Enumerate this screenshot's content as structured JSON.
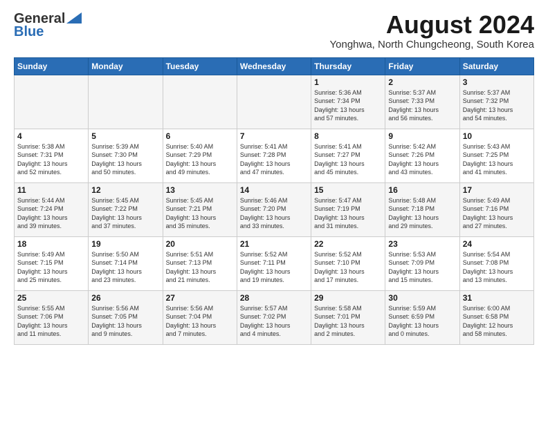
{
  "logo": {
    "general": "General",
    "blue": "Blue"
  },
  "title": "August 2024",
  "location": "Yonghwa, North Chungcheong, South Korea",
  "days_header": [
    "Sunday",
    "Monday",
    "Tuesday",
    "Wednesday",
    "Thursday",
    "Friday",
    "Saturday"
  ],
  "weeks": [
    [
      {
        "num": "",
        "info": ""
      },
      {
        "num": "",
        "info": ""
      },
      {
        "num": "",
        "info": ""
      },
      {
        "num": "",
        "info": ""
      },
      {
        "num": "1",
        "info": "Sunrise: 5:36 AM\nSunset: 7:34 PM\nDaylight: 13 hours\nand 57 minutes."
      },
      {
        "num": "2",
        "info": "Sunrise: 5:37 AM\nSunset: 7:33 PM\nDaylight: 13 hours\nand 56 minutes."
      },
      {
        "num": "3",
        "info": "Sunrise: 5:37 AM\nSunset: 7:32 PM\nDaylight: 13 hours\nand 54 minutes."
      }
    ],
    [
      {
        "num": "4",
        "info": "Sunrise: 5:38 AM\nSunset: 7:31 PM\nDaylight: 13 hours\nand 52 minutes."
      },
      {
        "num": "5",
        "info": "Sunrise: 5:39 AM\nSunset: 7:30 PM\nDaylight: 13 hours\nand 50 minutes."
      },
      {
        "num": "6",
        "info": "Sunrise: 5:40 AM\nSunset: 7:29 PM\nDaylight: 13 hours\nand 49 minutes."
      },
      {
        "num": "7",
        "info": "Sunrise: 5:41 AM\nSunset: 7:28 PM\nDaylight: 13 hours\nand 47 minutes."
      },
      {
        "num": "8",
        "info": "Sunrise: 5:41 AM\nSunset: 7:27 PM\nDaylight: 13 hours\nand 45 minutes."
      },
      {
        "num": "9",
        "info": "Sunrise: 5:42 AM\nSunset: 7:26 PM\nDaylight: 13 hours\nand 43 minutes."
      },
      {
        "num": "10",
        "info": "Sunrise: 5:43 AM\nSunset: 7:25 PM\nDaylight: 13 hours\nand 41 minutes."
      }
    ],
    [
      {
        "num": "11",
        "info": "Sunrise: 5:44 AM\nSunset: 7:24 PM\nDaylight: 13 hours\nand 39 minutes."
      },
      {
        "num": "12",
        "info": "Sunrise: 5:45 AM\nSunset: 7:22 PM\nDaylight: 13 hours\nand 37 minutes."
      },
      {
        "num": "13",
        "info": "Sunrise: 5:45 AM\nSunset: 7:21 PM\nDaylight: 13 hours\nand 35 minutes."
      },
      {
        "num": "14",
        "info": "Sunrise: 5:46 AM\nSunset: 7:20 PM\nDaylight: 13 hours\nand 33 minutes."
      },
      {
        "num": "15",
        "info": "Sunrise: 5:47 AM\nSunset: 7:19 PM\nDaylight: 13 hours\nand 31 minutes."
      },
      {
        "num": "16",
        "info": "Sunrise: 5:48 AM\nSunset: 7:18 PM\nDaylight: 13 hours\nand 29 minutes."
      },
      {
        "num": "17",
        "info": "Sunrise: 5:49 AM\nSunset: 7:16 PM\nDaylight: 13 hours\nand 27 minutes."
      }
    ],
    [
      {
        "num": "18",
        "info": "Sunrise: 5:49 AM\nSunset: 7:15 PM\nDaylight: 13 hours\nand 25 minutes."
      },
      {
        "num": "19",
        "info": "Sunrise: 5:50 AM\nSunset: 7:14 PM\nDaylight: 13 hours\nand 23 minutes."
      },
      {
        "num": "20",
        "info": "Sunrise: 5:51 AM\nSunset: 7:13 PM\nDaylight: 13 hours\nand 21 minutes."
      },
      {
        "num": "21",
        "info": "Sunrise: 5:52 AM\nSunset: 7:11 PM\nDaylight: 13 hours\nand 19 minutes."
      },
      {
        "num": "22",
        "info": "Sunrise: 5:52 AM\nSunset: 7:10 PM\nDaylight: 13 hours\nand 17 minutes."
      },
      {
        "num": "23",
        "info": "Sunrise: 5:53 AM\nSunset: 7:09 PM\nDaylight: 13 hours\nand 15 minutes."
      },
      {
        "num": "24",
        "info": "Sunrise: 5:54 AM\nSunset: 7:08 PM\nDaylight: 13 hours\nand 13 minutes."
      }
    ],
    [
      {
        "num": "25",
        "info": "Sunrise: 5:55 AM\nSunset: 7:06 PM\nDaylight: 13 hours\nand 11 minutes."
      },
      {
        "num": "26",
        "info": "Sunrise: 5:56 AM\nSunset: 7:05 PM\nDaylight: 13 hours\nand 9 minutes."
      },
      {
        "num": "27",
        "info": "Sunrise: 5:56 AM\nSunset: 7:04 PM\nDaylight: 13 hours\nand 7 minutes."
      },
      {
        "num": "28",
        "info": "Sunrise: 5:57 AM\nSunset: 7:02 PM\nDaylight: 13 hours\nand 4 minutes."
      },
      {
        "num": "29",
        "info": "Sunrise: 5:58 AM\nSunset: 7:01 PM\nDaylight: 13 hours\nand 2 minutes."
      },
      {
        "num": "30",
        "info": "Sunrise: 5:59 AM\nSunset: 6:59 PM\nDaylight: 13 hours\nand 0 minutes."
      },
      {
        "num": "31",
        "info": "Sunrise: 6:00 AM\nSunset: 6:58 PM\nDaylight: 12 hours\nand 58 minutes."
      }
    ]
  ]
}
